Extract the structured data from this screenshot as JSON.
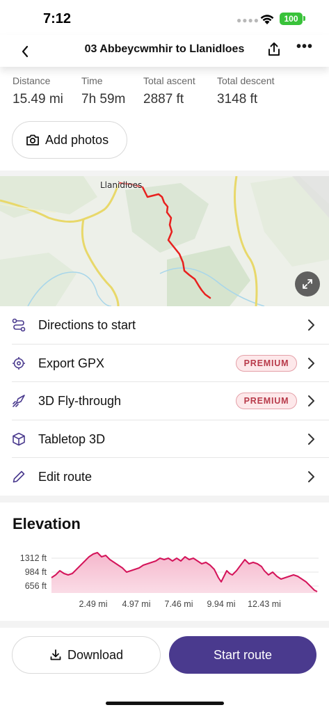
{
  "status_bar": {
    "time": "7:12",
    "battery": "100"
  },
  "header": {
    "title": "03 Abbeycwmhir to Llanidloes"
  },
  "stats": [
    {
      "label": "Distance",
      "value": "15.49 mi"
    },
    {
      "label": "Time",
      "value": "7h 59m"
    },
    {
      "label": "Total ascent",
      "value": "2887 ft"
    },
    {
      "label": "Total descent",
      "value": "3148 ft"
    }
  ],
  "add_photos_label": "Add photos",
  "map": {
    "place_label": "Llanidloes",
    "route_color": "#e8201e"
  },
  "menu": [
    {
      "icon": "route-icon",
      "label": "Directions to start"
    },
    {
      "icon": "target-icon",
      "label": "Export GPX",
      "badge": "PREMIUM"
    },
    {
      "icon": "rocket-icon",
      "label": "3D Fly-through",
      "badge": "PREMIUM"
    },
    {
      "icon": "cube-icon",
      "label": "Tabletop 3D"
    },
    {
      "icon": "pencil-icon",
      "label": "Edit route"
    }
  ],
  "elevation": {
    "title": "Elevation",
    "y_ticks": [
      "1312 ft",
      "984 ft",
      "656 ft"
    ],
    "x_ticks": [
      "2.49 mi",
      "4.97 mi",
      "7.46 mi",
      "9.94 mi",
      "12.43 mi"
    ],
    "line_color": "#d4145a"
  },
  "buttons": {
    "download": "Download",
    "start_route": "Start route"
  },
  "colors": {
    "primary": "#4a3a8e",
    "premium_text": "#b83a4a",
    "premium_bg": "#fde8ea"
  }
}
